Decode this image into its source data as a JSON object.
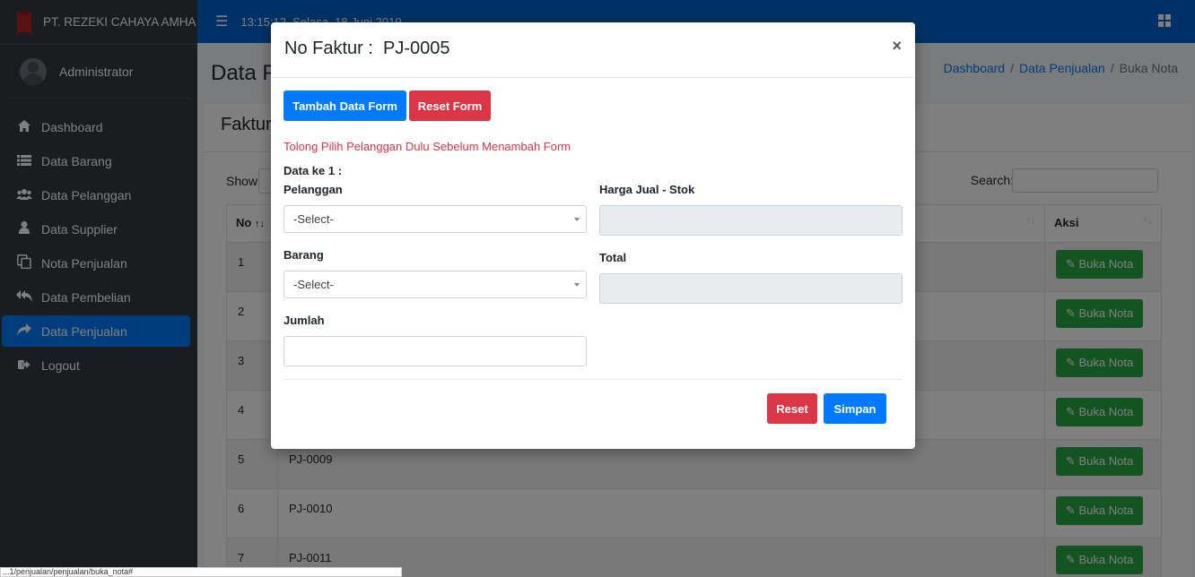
{
  "app": {
    "brand": "PT. REZEKI CAHAYA AMHA",
    "user": "Administrator",
    "clock": "13:15:12, Selasa, 18 Juni 2019"
  },
  "sidebar": {
    "items": [
      {
        "label": "Dashboard",
        "icon": "home-icon"
      },
      {
        "label": "Data Barang",
        "icon": "list-icon"
      },
      {
        "label": "Data Pelanggan",
        "icon": "users-icon"
      },
      {
        "label": "Data Supplier",
        "icon": "user-icon"
      },
      {
        "label": "Nota Penjualan",
        "icon": "copy-icon"
      },
      {
        "label": "Data Pembelian",
        "icon": "reply-all-icon"
      },
      {
        "label": "Data Penjualan",
        "icon": "share-icon"
      },
      {
        "label": "Logout",
        "icon": "sign-out-icon"
      }
    ],
    "active": "Data Penjualan"
  },
  "page": {
    "title": "Data P",
    "card_title": "Faktur",
    "breadcrumb": [
      "Dashboard",
      "Data Penjualan",
      "Buka Nota"
    ],
    "show_label": "Show",
    "search_label": "Search:"
  },
  "table": {
    "headers": {
      "no": "No",
      "aksi": "Aksi"
    },
    "rows": [
      {
        "no": "1",
        "faktur": ""
      },
      {
        "no": "2",
        "faktur": ""
      },
      {
        "no": "3",
        "faktur": ""
      },
      {
        "no": "4",
        "faktur": ""
      },
      {
        "no": "5",
        "faktur": "PJ-0009"
      },
      {
        "no": "6",
        "faktur": "PJ-0010"
      },
      {
        "no": "7",
        "faktur": "PJ-0011"
      }
    ],
    "action_label": "Buka Nota"
  },
  "modal": {
    "title": "No Faktur :  PJ-0005",
    "close": "×",
    "add_form": "Tambah Data Form",
    "reset_form": "Reset Form",
    "warning": "Tolong Pilih Pelanggan Dulu Sebelum Menambah Form",
    "data_label": "Data ke 1 :",
    "pelanggan_label": "Pelanggan",
    "pelanggan_value": "-Select-",
    "barang_label": "Barang",
    "barang_value": "-Select-",
    "jumlah_label": "Jumlah",
    "harga_label": "Harga Jual - Stok",
    "total_label": "Total",
    "reset": "Reset",
    "simpan": "Simpan"
  },
  "statusbar": "...1/penjualan/penjualan/buka_nota#",
  "colors": {
    "primary": "#007bff",
    "danger": "#dc3545",
    "success": "#28a745",
    "sidebar": "#343a40"
  }
}
